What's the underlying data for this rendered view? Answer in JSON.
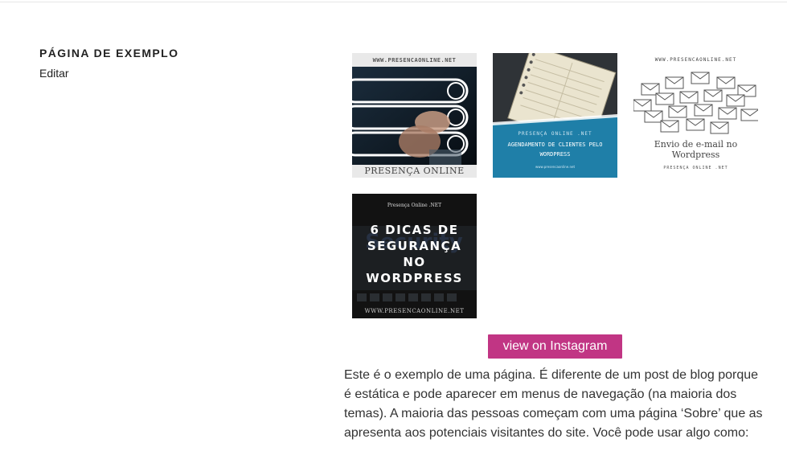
{
  "page": {
    "title": "PÁGINA DE EXEMPLO",
    "edit_label": "Editar"
  },
  "instagram": {
    "button_label": "view on Instagram",
    "accent_color": "#c13584",
    "posts": [
      {
        "caption_top": "WWW.PRESENCAONLINE.NET",
        "caption_bottom": "PRESENÇA ONLINE .NET",
        "icon": "touchscreen-finger-icon"
      },
      {
        "caption_top": "PRESENÇA ONLINE .NET",
        "caption_main_1": "AGENDAMENTO DE CLIENTES PELO",
        "caption_main_2": "WORDPRESS",
        "caption_small": "www.presencaonline.net",
        "icon": "planner-notebook-icon"
      },
      {
        "caption_top": "WWW.PRESENCAONLINE.NET",
        "caption_main_1": "Envio de e-mail no",
        "caption_main_2": "Wordpress",
        "caption_small": "PRESENÇA ONLINE .NET",
        "icon": "envelopes-icon"
      },
      {
        "caption_top": "Presença Online .NET",
        "line1": "6 DICAS DE",
        "line2": "SEGURANÇA",
        "line3": "NO",
        "line4": "WORDPRESS",
        "caption_bottom": "WWW.PRESENCAONLINE.NET",
        "icon": "security-keyboard-icon"
      }
    ]
  },
  "content": {
    "paragraph": "Este é o exemplo de uma página. É diferente de um post de blog porque é estática e pode aparecer em menus de navegação (na maioria dos temas). A maioria das pessoas começam com uma página ‘Sobre’ que as apresenta aos potenciais visitantes do site. Você pode usar algo como:"
  }
}
